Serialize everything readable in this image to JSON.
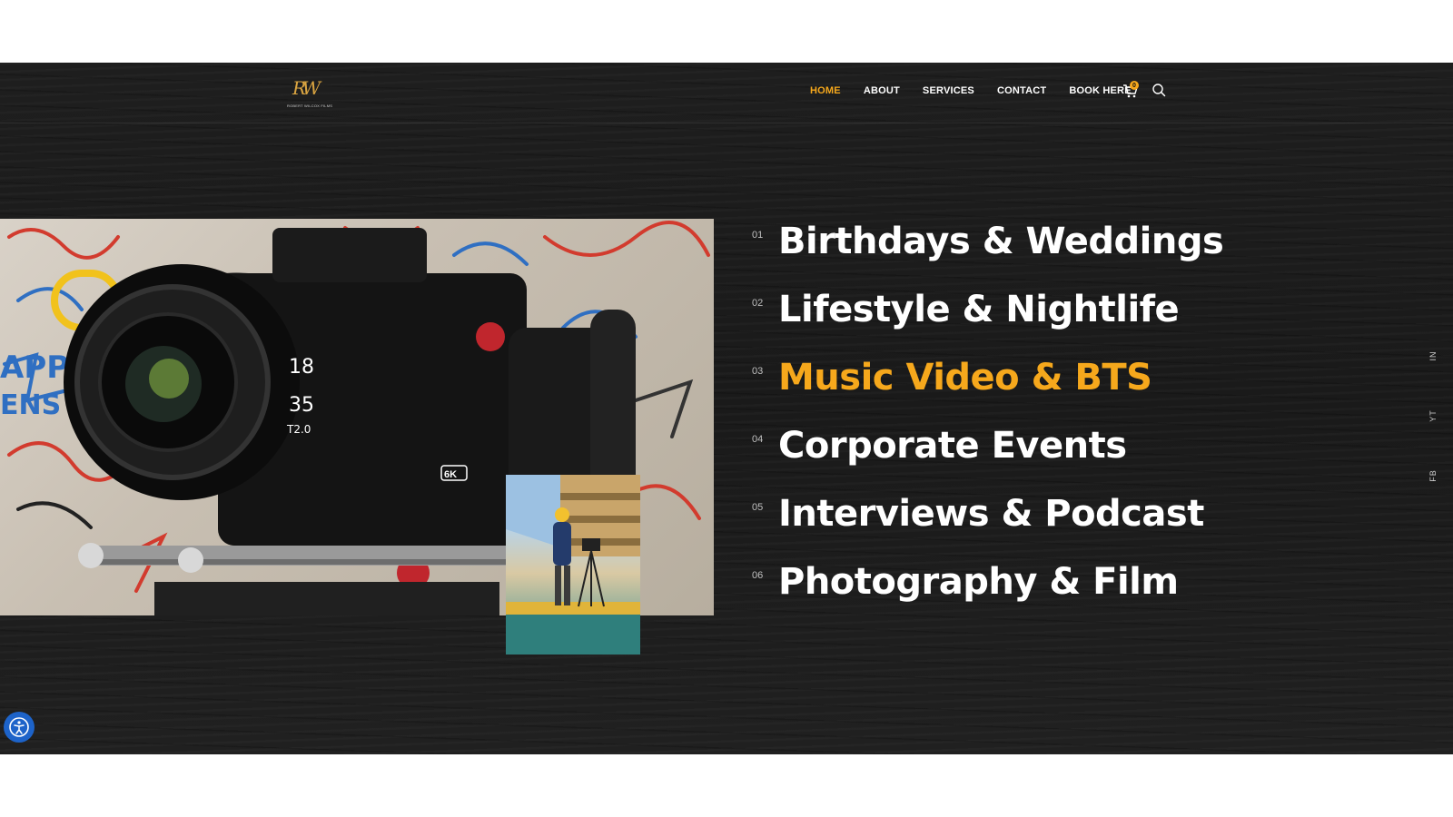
{
  "header": {
    "logo_monogram": "RW",
    "logo_subtitle": "ROBERT WILCOX FILMS",
    "nav": [
      {
        "label": "HOME",
        "active": true
      },
      {
        "label": "ABOUT",
        "active": false
      },
      {
        "label": "SERVICES",
        "active": false
      },
      {
        "label": "CONTACT",
        "active": false
      },
      {
        "label": "BOOK HERE",
        "active": false
      }
    ],
    "cart_count": "0",
    "icons": [
      "cart-icon",
      "search-icon"
    ]
  },
  "hero": {
    "main_image": "cinema-camera-graffiti",
    "inset_image": "camera-operator-rooftop"
  },
  "services": [
    {
      "num": "01",
      "title": "Birthdays & Weddings",
      "active": false
    },
    {
      "num": "02",
      "title": "Lifestyle & Nightlife",
      "active": false
    },
    {
      "num": "03",
      "title": "Music Video & BTS",
      "active": true
    },
    {
      "num": "04",
      "title": "Corporate Events",
      "active": false
    },
    {
      "num": "05",
      "title": "Interviews & Podcast",
      "active": false
    },
    {
      "num": "06",
      "title": "Photography & Film",
      "active": false
    }
  ],
  "social": [
    "IN",
    "YT",
    "FB"
  ],
  "colors": {
    "accent": "#f6a81c",
    "background": "#1c1c1c",
    "text": "#ffffff",
    "accessibility_button": "#1d63c9"
  }
}
